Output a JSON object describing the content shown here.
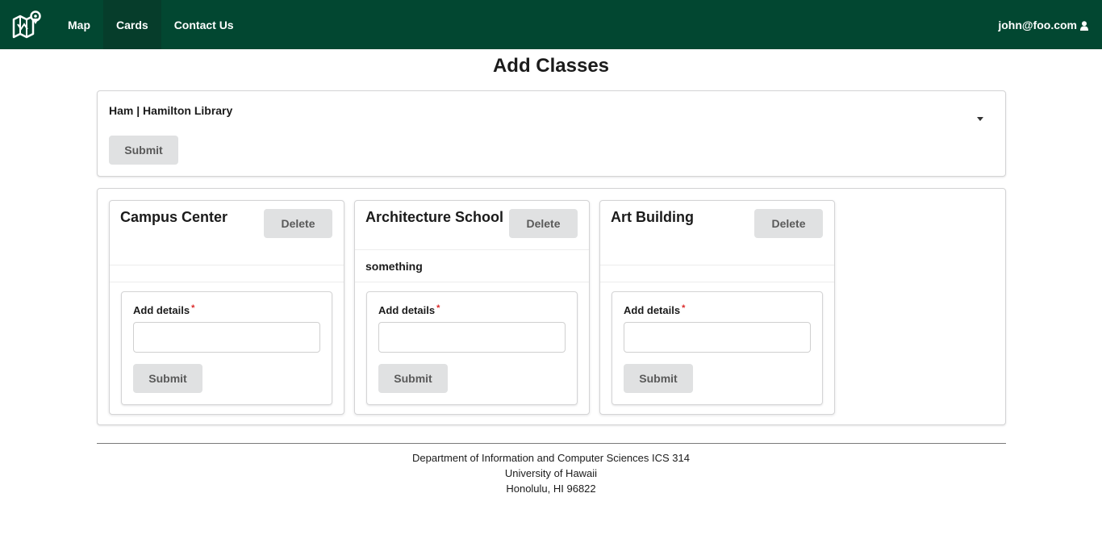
{
  "navbar": {
    "logo_icon": "map-pin-logo-icon",
    "items": [
      {
        "label": "Map",
        "active": false
      },
      {
        "label": "Cards",
        "active": true
      },
      {
        "label": "Contact Us",
        "active": false
      }
    ],
    "user_email": "john@foo.com",
    "user_icon": "user-icon",
    "bg_color": "#024731"
  },
  "page": {
    "title": "Add Classes"
  },
  "select_form": {
    "selected_value": "Ham | Hamilton Library",
    "submit_label": "Submit"
  },
  "cards": [
    {
      "title": "Campus Center",
      "description": "",
      "delete_label": "Delete",
      "field_label": "Add details",
      "required_mark": "*",
      "input_value": "",
      "submit_label": "Submit"
    },
    {
      "title": "Architecture School",
      "description": "something",
      "delete_label": "Delete",
      "field_label": "Add details",
      "required_mark": "*",
      "input_value": "",
      "submit_label": "Submit"
    },
    {
      "title": "Art Building",
      "description": "",
      "delete_label": "Delete",
      "field_label": "Add details",
      "required_mark": "*",
      "input_value": "",
      "submit_label": "Submit"
    }
  ],
  "footer": {
    "line1": "Department of Information and Computer Sciences ICS 314",
    "line2": "University of Hawaii",
    "line3": "Honolulu, HI 96822"
  }
}
